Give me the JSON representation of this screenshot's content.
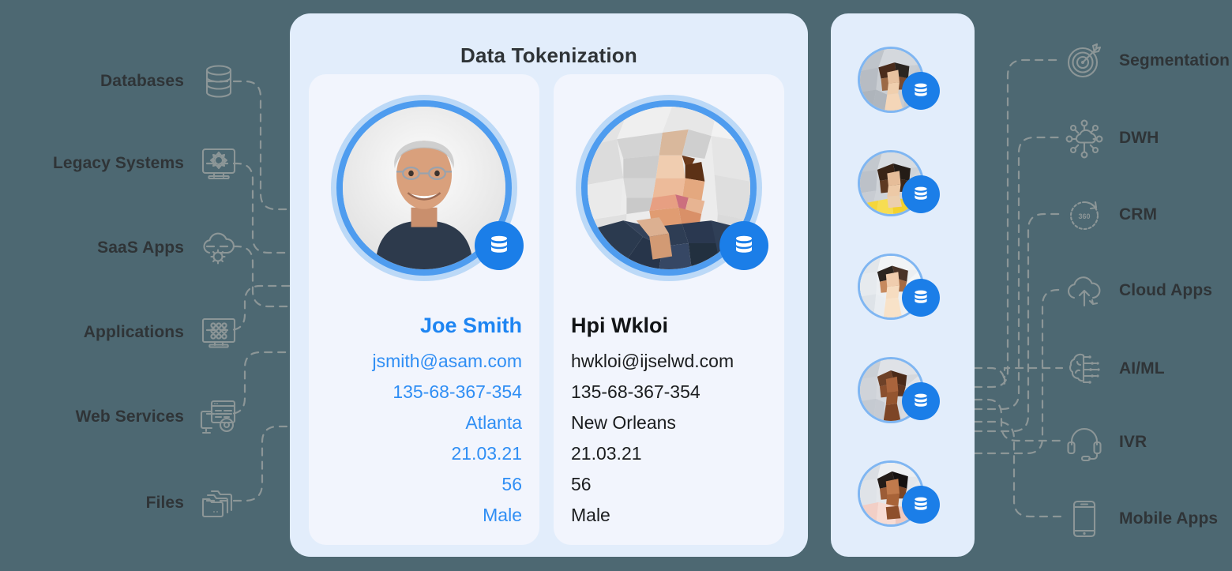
{
  "colors": {
    "background": "#4d6872",
    "panel": "#e2edfb",
    "card": "#f2f5fd",
    "accent_blue": "#1b7ee8",
    "text_blue": "#2f8ef4",
    "text_dark": "#2f3437",
    "wire": "#8c9697",
    "icon": "#8c9697"
  },
  "sources": {
    "items": [
      {
        "label": "Databases",
        "icon": "database-icon"
      },
      {
        "label": "Legacy Systems",
        "icon": "legacy-monitor-gear-icon"
      },
      {
        "label": "SaaS Apps",
        "icon": "cloud-gear-icon"
      },
      {
        "label": "Applications",
        "icon": "monitor-grid-icon"
      },
      {
        "label": "Web Services",
        "icon": "web-services-icon"
      },
      {
        "label": "Files",
        "icon": "folders-icon"
      }
    ]
  },
  "destinations": {
    "items": [
      {
        "label": "Segmentation",
        "icon": "target-icon"
      },
      {
        "label": "DWH",
        "icon": "data-warehouse-hub-icon"
      },
      {
        "label": "CRM",
        "icon": "crm-360-icon",
        "inner_text": "360"
      },
      {
        "label": "Cloud Apps",
        "icon": "cloud-upload-icon"
      },
      {
        "label": "AI/ML",
        "icon": "brain-chip-icon"
      },
      {
        "label": "IVR",
        "icon": "headset-icon"
      },
      {
        "label": "Mobile Apps",
        "icon": "mobile-phone-icon"
      }
    ]
  },
  "center": {
    "title": "Data Tokenization",
    "cards": [
      {
        "side": "left",
        "avatar": "photo-original-avatar",
        "badge_icon": "database-badge-icon",
        "fields": [
          "Joe Smith",
          "jsmith@asam.com",
          "135-68-367-354",
          "Atlanta",
          "21.03.21",
          "56",
          "Male"
        ]
      },
      {
        "side": "right",
        "avatar": "photo-tokenized-avatar",
        "badge_icon": "database-badge-icon",
        "fields": [
          "Hpi Wkloi",
          "hwkloi@ijselwd.com",
          "135-68-367-354",
          "New Orleans",
          "21.03.21",
          "56",
          "Male"
        ]
      }
    ]
  },
  "token_strip": {
    "items": [
      {
        "avatar": "tokenized-avatar-1",
        "badge_icon": "database-badge-icon"
      },
      {
        "avatar": "tokenized-avatar-2",
        "badge_icon": "database-badge-icon"
      },
      {
        "avatar": "tokenized-avatar-3",
        "badge_icon": "database-badge-icon"
      },
      {
        "avatar": "tokenized-avatar-4",
        "badge_icon": "database-badge-icon"
      },
      {
        "avatar": "tokenized-avatar-5",
        "badge_icon": "database-badge-icon"
      }
    ]
  }
}
